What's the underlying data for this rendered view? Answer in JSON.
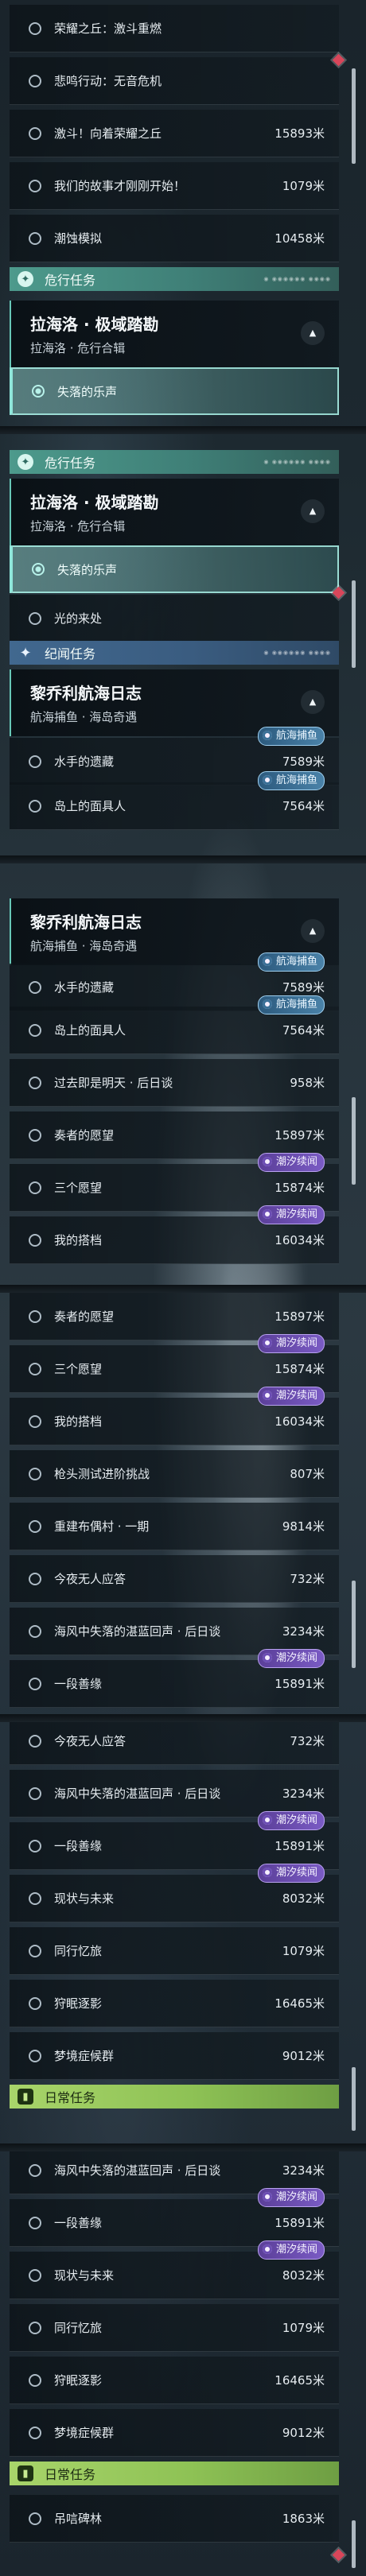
{
  "screens": [
    {
      "items": [
        {
          "type": "row",
          "name": "荣耀之丘：激斗重燃",
          "dist": ""
        },
        {
          "type": "row",
          "name": "悲鸣行动：无音危机",
          "dist": ""
        },
        {
          "type": "row",
          "name": "激斗！向着荣耀之丘",
          "dist": "15893米"
        },
        {
          "type": "row",
          "name": "我们的故事才刚刚开始！",
          "dist": "1079米"
        },
        {
          "type": "row",
          "name": "潮蚀模拟",
          "dist": "10458米"
        },
        {
          "type": "cat",
          "style": "teal",
          "title": "危行任务",
          "icon": "✦",
          "deco": "◉ ◉◉◉◉◉◉ ◉◉◉◉"
        },
        {
          "type": "hdr",
          "title": "拉海洛 · 极域踏勘",
          "sub": "拉海洛 · 危行合辑",
          "chev": "▲"
        },
        {
          "type": "row",
          "name": "失落的乐声",
          "dist": "",
          "sel": true
        }
      ]
    },
    {
      "items": [
        {
          "type": "cat",
          "style": "teal",
          "title": "危行任务",
          "icon": "✦",
          "deco": "◉ ◉◉◉◉◉◉ ◉◉◉◉"
        },
        {
          "type": "hdr",
          "title": "拉海洛 · 极域踏勘",
          "sub": "拉海洛 · 危行合辑",
          "chev": "▲"
        },
        {
          "type": "row",
          "name": "失落的乐声",
          "dist": "",
          "sel": true
        },
        {
          "type": "row",
          "name": "光的来处",
          "dist": ""
        },
        {
          "type": "cat",
          "style": "blue",
          "title": "纪闻任务",
          "icon": "✦",
          "deco": "◉ ◉◉◉◉◉◉ ◉◉◉◉"
        },
        {
          "type": "hdr",
          "title": "黎乔利航海日志",
          "sub": "航海捕鱼 · 海岛奇遇",
          "chev": "▲"
        },
        {
          "type": "row",
          "name": "水手的遗藏",
          "dist": "7589米",
          "tag": "航海捕鱼",
          "tagStyle": "blue"
        },
        {
          "type": "row",
          "name": "岛上的面具人",
          "dist": "7564米",
          "tag": "航海捕鱼",
          "tagStyle": "blue"
        }
      ]
    },
    {
      "items": [
        {
          "type": "hdr",
          "title": "黎乔利航海日志",
          "sub": "航海捕鱼 · 海岛奇遇",
          "chev": "▲"
        },
        {
          "type": "row",
          "name": "水手的遗藏",
          "dist": "7589米",
          "tag": "航海捕鱼",
          "tagStyle": "blue"
        },
        {
          "type": "row",
          "name": "岛上的面具人",
          "dist": "7564米",
          "tag": "航海捕鱼",
          "tagStyle": "blue"
        },
        {
          "type": "row",
          "name": "过去即是明天 · 后日谈",
          "dist": "958米"
        },
        {
          "type": "row",
          "name": "奏者的愿望",
          "dist": "15897米"
        },
        {
          "type": "row",
          "name": "三个愿望",
          "dist": "15874米",
          "tag": "潮汐续闻"
        },
        {
          "type": "row",
          "name": "我的搭档",
          "dist": "16034米",
          "tag": "潮汐续闻"
        }
      ]
    },
    {
      "items": [
        {
          "type": "row",
          "name": "奏者的愿望",
          "dist": "15897米"
        },
        {
          "type": "row",
          "name": "三个愿望",
          "dist": "15874米",
          "tag": "潮汐续闻"
        },
        {
          "type": "row",
          "name": "我的搭档",
          "dist": "16034米",
          "tag": "潮汐续闻"
        },
        {
          "type": "row",
          "name": "枪头测试进阶挑战",
          "dist": "807米"
        },
        {
          "type": "row",
          "name": "重建布偶村 · 一期",
          "dist": "9814米"
        },
        {
          "type": "row",
          "name": "今夜无人应答",
          "dist": "732米"
        },
        {
          "type": "row",
          "name": "海风中失落的湛蓝回声 · 后日谈",
          "dist": "3234米"
        },
        {
          "type": "row",
          "name": "一段善缘",
          "dist": "15891米",
          "tag": "潮汐续闻"
        }
      ]
    },
    {
      "items": [
        {
          "type": "row",
          "name": "今夜无人应答",
          "dist": "732米"
        },
        {
          "type": "row",
          "name": "海风中失落的湛蓝回声 · 后日谈",
          "dist": "3234米"
        },
        {
          "type": "row",
          "name": "一段善缘",
          "dist": "15891米",
          "tag": "潮汐续闻"
        },
        {
          "type": "row",
          "name": "现状与未来",
          "dist": "8032米",
          "tag": "潮汐续闻"
        },
        {
          "type": "row",
          "name": "同行忆旅",
          "dist": "1079米"
        },
        {
          "type": "row",
          "name": "狩眠逐影",
          "dist": "16465米"
        },
        {
          "type": "row",
          "name": "梦境症候群",
          "dist": "9012米"
        },
        {
          "type": "cat",
          "style": "green",
          "title": "日常任务",
          "icon": "▮",
          "deco": ""
        }
      ]
    },
    {
      "items": [
        {
          "type": "row",
          "name": "海风中失落的湛蓝回声 · 后日谈",
          "dist": "3234米"
        },
        {
          "type": "row",
          "name": "一段善缘",
          "dist": "15891米",
          "tag": "潮汐续闻"
        },
        {
          "type": "row",
          "name": "现状与未来",
          "dist": "8032米",
          "tag": "潮汐续闻"
        },
        {
          "type": "row",
          "name": "同行忆旅",
          "dist": "1079米"
        },
        {
          "type": "row",
          "name": "狩眠逐影",
          "dist": "16465米"
        },
        {
          "type": "row",
          "name": "梦境症候群",
          "dist": "9012米"
        },
        {
          "type": "cat",
          "style": "green",
          "title": "日常任务",
          "icon": "▮",
          "deco": ""
        },
        {
          "type": "row",
          "name": "吊唁碑林",
          "dist": "1863米"
        }
      ]
    }
  ]
}
